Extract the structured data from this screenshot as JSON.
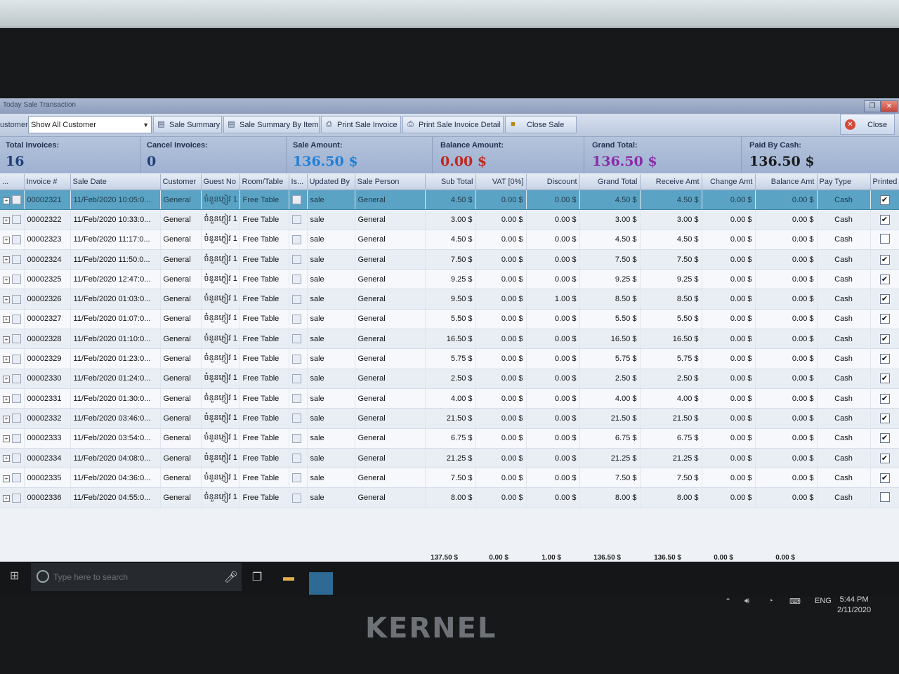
{
  "window": {
    "title": "Today Sale Transaction"
  },
  "toolbar": {
    "customer_label": "ustomer:",
    "customer_value": "Show All Customer",
    "buttons": [
      "Sale Summary",
      "Sale Summary By Item",
      "Print Sale Invoice",
      "Print Sale Invoice Detail",
      "Close Sale"
    ],
    "close_label": "Close"
  },
  "summary": {
    "total_invoices": {
      "label": "Total Invoices:",
      "value": "16"
    },
    "cancel_invoices": {
      "label": "Cancel Invoices:",
      "value": "0"
    },
    "sale_amount": {
      "label": "Sale Amount:",
      "value": "136.50 $"
    },
    "balance_amount": {
      "label": "Balance Amount:",
      "value": "0.00 $"
    },
    "grand_total": {
      "label": "Grand Total:",
      "value": "136.50 $"
    },
    "paid_by_cash": {
      "label": "Paid By Cash:",
      "value": "136.50 $"
    },
    "colors": {
      "sale": "#1f7fd6",
      "balance": "#c2281f",
      "grand": "#8a2ca8",
      "paid": "#1c1c1c",
      "count": "#1f3f7a"
    }
  },
  "grid": {
    "columns": [
      "...",
      "Invoice #",
      "Sale Date",
      "Customer",
      "Guest No",
      "Room/Table",
      "Is...",
      "Updated By",
      "Sale Person",
      "Sub Total",
      "VAT [0%]",
      "Discount",
      "Grand Total",
      "Receive Amt",
      "Change Amt",
      "Balance Amt",
      "Pay Type",
      "Printed"
    ],
    "rows": [
      [
        "00002321",
        "11/Feb/2020 10:05:0...",
        "General",
        "ចំនួនភ្ញៀវ 1",
        "Free Table",
        "sale",
        "General",
        "4.50 $",
        "0.00 $",
        "0.00 $",
        "4.50 $",
        "4.50 $",
        "0.00 $",
        "0.00 $",
        "Cash",
        "✔"
      ],
      [
        "00002322",
        "11/Feb/2020 10:33:0...",
        "General",
        "ចំនួនភ្ញៀវ 1",
        "Free Table",
        "sale",
        "General",
        "3.00 $",
        "0.00 $",
        "0.00 $",
        "3.00 $",
        "3.00 $",
        "0.00 $",
        "0.00 $",
        "Cash",
        "✔"
      ],
      [
        "00002323",
        "11/Feb/2020 11:17:0...",
        "General",
        "ចំនួនភ្ញៀវ 1",
        "Free Table",
        "sale",
        "General",
        "4.50 $",
        "0.00 $",
        "0.00 $",
        "4.50 $",
        "4.50 $",
        "0.00 $",
        "0.00 $",
        "Cash",
        ""
      ],
      [
        "00002324",
        "11/Feb/2020 11:50:0...",
        "General",
        "ចំនួនភ្ញៀវ 1",
        "Free Table",
        "sale",
        "General",
        "7.50 $",
        "0.00 $",
        "0.00 $",
        "7.50 $",
        "7.50 $",
        "0.00 $",
        "0.00 $",
        "Cash",
        "✔"
      ],
      [
        "00002325",
        "11/Feb/2020 12:47:0...",
        "General",
        "ចំនួនភ្ញៀវ 1",
        "Free Table",
        "sale",
        "General",
        "9.25 $",
        "0.00 $",
        "0.00 $",
        "9.25 $",
        "9.25 $",
        "0.00 $",
        "0.00 $",
        "Cash",
        "✔"
      ],
      [
        "00002326",
        "11/Feb/2020 01:03:0...",
        "General",
        "ចំនួនភ្ញៀវ 1",
        "Free Table",
        "sale",
        "General",
        "9.50 $",
        "0.00 $",
        "1.00 $",
        "8.50 $",
        "8.50 $",
        "0.00 $",
        "0.00 $",
        "Cash",
        "✔"
      ],
      [
        "00002327",
        "11/Feb/2020 01:07:0...",
        "General",
        "ចំនួនភ្ញៀវ 1",
        "Free Table",
        "sale",
        "General",
        "5.50 $",
        "0.00 $",
        "0.00 $",
        "5.50 $",
        "5.50 $",
        "0.00 $",
        "0.00 $",
        "Cash",
        "✔"
      ],
      [
        "00002328",
        "11/Feb/2020 01:10:0...",
        "General",
        "ចំនួនភ្ញៀវ 1",
        "Free Table",
        "sale",
        "General",
        "16.50 $",
        "0.00 $",
        "0.00 $",
        "16.50 $",
        "16.50 $",
        "0.00 $",
        "0.00 $",
        "Cash",
        "✔"
      ],
      [
        "00002329",
        "11/Feb/2020 01:23:0...",
        "General",
        "ចំនួនភ្ញៀវ 1",
        "Free Table",
        "sale",
        "General",
        "5.75 $",
        "0.00 $",
        "0.00 $",
        "5.75 $",
        "5.75 $",
        "0.00 $",
        "0.00 $",
        "Cash",
        "✔"
      ],
      [
        "00002330",
        "11/Feb/2020 01:24:0...",
        "General",
        "ចំនួនភ្ញៀវ 1",
        "Free Table",
        "sale",
        "General",
        "2.50 $",
        "0.00 $",
        "0.00 $",
        "2.50 $",
        "2.50 $",
        "0.00 $",
        "0.00 $",
        "Cash",
        "✔"
      ],
      [
        "00002331",
        "11/Feb/2020 01:30:0...",
        "General",
        "ចំនួនភ្ញៀវ 1",
        "Free Table",
        "sale",
        "General",
        "4.00 $",
        "0.00 $",
        "0.00 $",
        "4.00 $",
        "4.00 $",
        "0.00 $",
        "0.00 $",
        "Cash",
        "✔"
      ],
      [
        "00002332",
        "11/Feb/2020 03:46:0...",
        "General",
        "ចំនួនភ្ញៀវ 1",
        "Free Table",
        "sale",
        "General",
        "21.50 $",
        "0.00 $",
        "0.00 $",
        "21.50 $",
        "21.50 $",
        "0.00 $",
        "0.00 $",
        "Cash",
        "✔"
      ],
      [
        "00002333",
        "11/Feb/2020 03:54:0...",
        "General",
        "ចំនួនភ្ញៀវ 1",
        "Free Table",
        "sale",
        "General",
        "6.75 $",
        "0.00 $",
        "0.00 $",
        "6.75 $",
        "6.75 $",
        "0.00 $",
        "0.00 $",
        "Cash",
        "✔"
      ],
      [
        "00002334",
        "11/Feb/2020 04:08:0...",
        "General",
        "ចំនួនភ្ញៀវ 1",
        "Free Table",
        "sale",
        "General",
        "21.25 $",
        "0.00 $",
        "0.00 $",
        "21.25 $",
        "21.25 $",
        "0.00 $",
        "0.00 $",
        "Cash",
        "✔"
      ],
      [
        "00002335",
        "11/Feb/2020 04:36:0...",
        "General",
        "ចំនួនភ្ញៀវ 1",
        "Free Table",
        "sale",
        "General",
        "7.50 $",
        "0.00 $",
        "0.00 $",
        "7.50 $",
        "7.50 $",
        "0.00 $",
        "0.00 $",
        "Cash",
        "✔"
      ],
      [
        "00002336",
        "11/Feb/2020 04:55:0...",
        "General",
        "ចំនួនភ្ញៀវ 1",
        "Free Table",
        "sale",
        "General",
        "8.00 $",
        "0.00 $",
        "0.00 $",
        "8.00 $",
        "8.00 $",
        "0.00 $",
        "0.00 $",
        "Cash",
        ""
      ]
    ],
    "selected_row": 0,
    "totals": [
      "137.50 $",
      "0.00 $",
      "1.00 $",
      "136.50 $",
      "136.50 $",
      "0.00 $",
      "0.00 $"
    ]
  },
  "taskbar": {
    "search_placeholder": "Type here to search",
    "lang": "ENG",
    "time": "5:44 PM",
    "date": "2/11/2020"
  },
  "monitor_brand": "KERNEL"
}
